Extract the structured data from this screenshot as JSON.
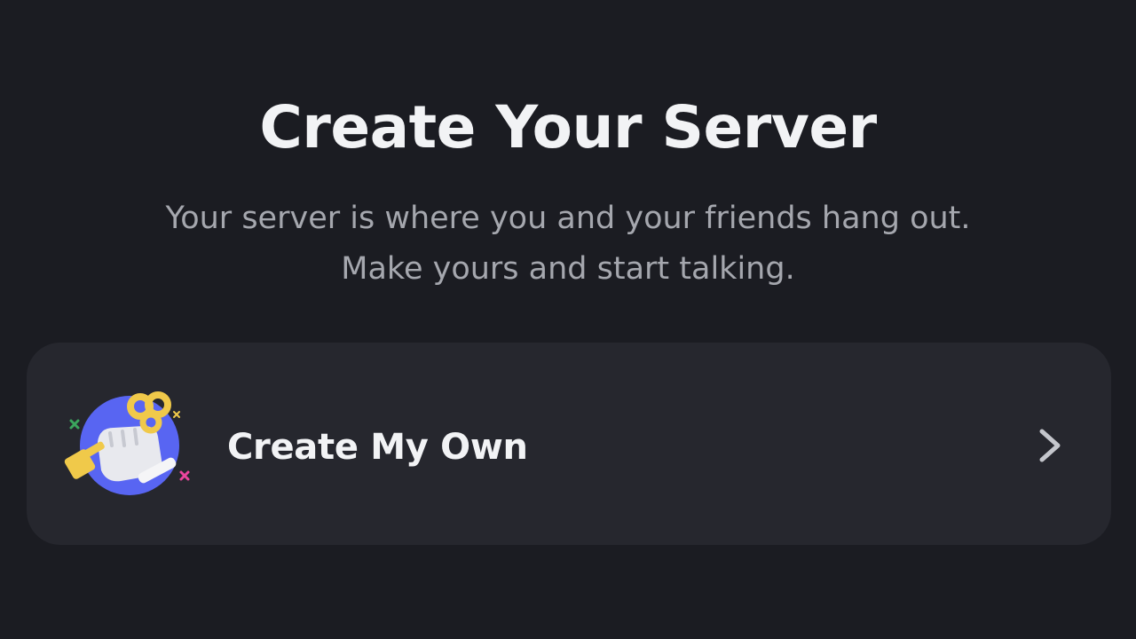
{
  "header": {
    "title": "Create Your Server",
    "subtitle_line1": "Your server is where you and your friends hang out.",
    "subtitle_line2": "Make yours and start talking."
  },
  "options": [
    {
      "label": "Create My Own",
      "icon": "create-server-illustration-icon",
      "trailing_icon": "chevron-right-icon"
    }
  ],
  "colors": {
    "background": "#1b1c22",
    "card": "#26272e",
    "title_text": "#f2f3f5",
    "subtitle_text": "#a5a7ae",
    "accent_blue": "#5865f2",
    "accent_yellow": "#f0c94a"
  }
}
